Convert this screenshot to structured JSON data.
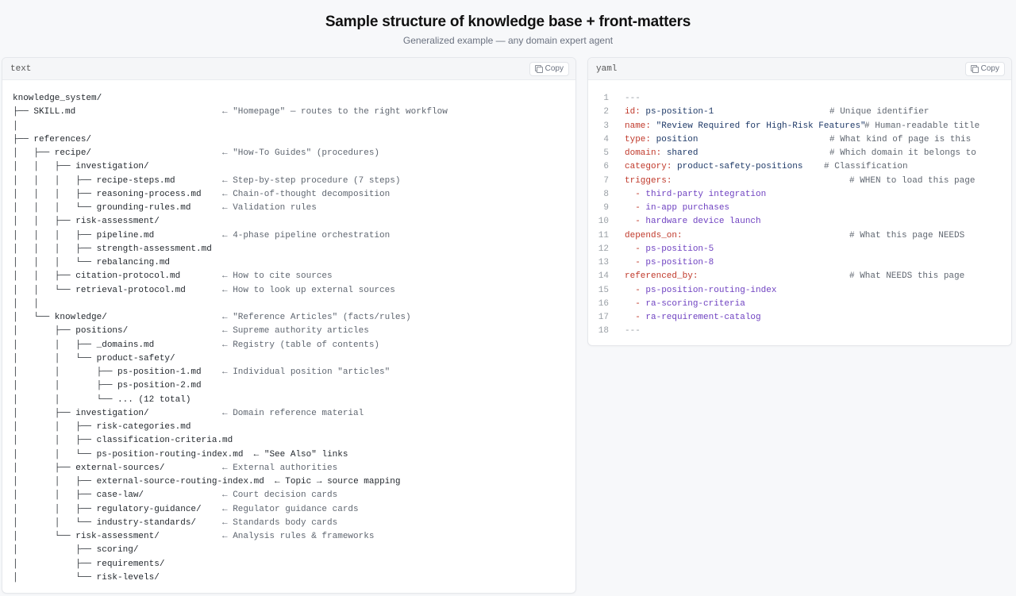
{
  "page": {
    "title": "Sample structure of knowledge base + front-matters",
    "subtitle": "Generalized example — any domain expert agent"
  },
  "text_panel": {
    "language": "text",
    "copy_label": "Copy",
    "lines": [
      {
        "tree": "knowledge_system/",
        "comment": ""
      },
      {
        "tree": "├── SKILL.md",
        "comment": "← \"Homepage\" — routes to the right workflow"
      },
      {
        "tree": "│",
        "comment": ""
      },
      {
        "tree": "├── references/",
        "comment": ""
      },
      {
        "tree": "│   ├── recipe/",
        "comment": "← \"How-To Guides\" (procedures)"
      },
      {
        "tree": "│   │   ├── investigation/",
        "comment": ""
      },
      {
        "tree": "│   │   │   ├── recipe-steps.md",
        "comment": "← Step-by-step procedure (7 steps)"
      },
      {
        "tree": "│   │   │   ├── reasoning-process.md",
        "comment": "← Chain-of-thought decomposition"
      },
      {
        "tree": "│   │   │   └── grounding-rules.md",
        "comment": "← Validation rules"
      },
      {
        "tree": "│   │   ├── risk-assessment/",
        "comment": ""
      },
      {
        "tree": "│   │   │   ├── pipeline.md",
        "comment": "← 4-phase pipeline orchestration"
      },
      {
        "tree": "│   │   │   ├── strength-assessment.md",
        "comment": ""
      },
      {
        "tree": "│   │   │   └── rebalancing.md",
        "comment": ""
      },
      {
        "tree": "│   │   ├── citation-protocol.md",
        "comment": "← How to cite sources"
      },
      {
        "tree": "│   │   └── retrieval-protocol.md",
        "comment": "← How to look up external sources"
      },
      {
        "tree": "│   │",
        "comment": ""
      },
      {
        "tree": "│   └── knowledge/",
        "comment": "← \"Reference Articles\" (facts/rules)"
      },
      {
        "tree": "│       ├── positions/",
        "comment": "← Supreme authority articles"
      },
      {
        "tree": "│       │   ├── _domains.md",
        "comment": "← Registry (table of contents)"
      },
      {
        "tree": "│       │   └── product-safety/",
        "comment": ""
      },
      {
        "tree": "│       │       ├── ps-position-1.md",
        "comment": "← Individual position \"articles\""
      },
      {
        "tree": "│       │       ├── ps-position-2.md",
        "comment": ""
      },
      {
        "tree": "│       │       └── ... (12 total)",
        "comment": ""
      },
      {
        "tree": "│       ├── investigation/",
        "comment": "← Domain reference material"
      },
      {
        "tree": "│       │   ├── risk-categories.md",
        "comment": ""
      },
      {
        "tree": "│       │   ├── classification-criteria.md",
        "comment": ""
      },
      {
        "tree": "│       │   └── ps-position-routing-index.md  ← \"See Also\" links",
        "comment": ""
      },
      {
        "tree": "│       ├── external-sources/",
        "comment": "← External authorities"
      },
      {
        "tree": "│       │   ├── external-source-routing-index.md  ← Topic → source mapping",
        "comment": ""
      },
      {
        "tree": "│       │   ├── case-law/",
        "comment": "← Court decision cards"
      },
      {
        "tree": "│       │   ├── regulatory-guidance/",
        "comment": "← Regulator guidance cards"
      },
      {
        "tree": "│       │   └── industry-standards/",
        "comment": "← Standards body cards"
      },
      {
        "tree": "│       └── risk-assessment/",
        "comment": "← Analysis rules & frameworks"
      },
      {
        "tree": "│           ├── scoring/",
        "comment": ""
      },
      {
        "tree": "│           ├── requirements/",
        "comment": ""
      },
      {
        "tree": "│           └── risk-levels/",
        "comment": ""
      }
    ]
  },
  "yaml_panel": {
    "language": "yaml",
    "copy_label": "Copy",
    "lines": [
      {
        "n": "1",
        "key": "",
        "sep": "",
        "value": "",
        "plain": "---",
        "comment": "",
        "cpos": 0
      },
      {
        "n": "2",
        "key": "id",
        "sep": ":",
        "value": " ps-position-1",
        "plain": "",
        "comment": "# Unique identifier",
        "cpos": 258
      },
      {
        "n": "3",
        "key": "name",
        "sep": ":",
        "value": " \"Review Required for High-Risk Features\"",
        "plain": "",
        "comment": "# Human-readable title",
        "cpos": 302
      },
      {
        "n": "4",
        "key": "type",
        "sep": ":",
        "value": " position",
        "plain": "",
        "comment": "# What kind of page is this",
        "cpos": 258
      },
      {
        "n": "5",
        "key": "domain",
        "sep": ":",
        "value": " shared",
        "plain": "",
        "comment": "# Which domain it belongs to",
        "cpos": 258
      },
      {
        "n": "6",
        "key": "category",
        "sep": ":",
        "value": " product-safety-positions",
        "plain": "",
        "comment": "# Classification",
        "cpos": 251
      },
      {
        "n": "7",
        "key": "triggers",
        "sep": ":",
        "value": "",
        "plain": "",
        "comment": "# WHEN to load this page",
        "cpos": 283
      },
      {
        "n": "8",
        "key": "",
        "sep": "",
        "value": "",
        "item": "third-party integration",
        "comment": "",
        "cpos": 0
      },
      {
        "n": "9",
        "key": "",
        "sep": "",
        "value": "",
        "item": "in-app purchases",
        "comment": "",
        "cpos": 0
      },
      {
        "n": "10",
        "key": "",
        "sep": "",
        "value": "",
        "item": "hardware device launch",
        "comment": "",
        "cpos": 0
      },
      {
        "n": "11",
        "key": "depends_on",
        "sep": ":",
        "value": "",
        "plain": "",
        "comment": "# What this page NEEDS",
        "cpos": 283
      },
      {
        "n": "12",
        "key": "",
        "sep": "",
        "value": "",
        "item": "ps-position-5",
        "comment": "",
        "cpos": 0
      },
      {
        "n": "13",
        "key": "",
        "sep": "",
        "value": "",
        "item": "ps-position-8",
        "comment": "",
        "cpos": 0
      },
      {
        "n": "14",
        "key": "referenced_by",
        "sep": ":",
        "value": "",
        "plain": "",
        "comment": "# What NEEDS this page",
        "cpos": 283
      },
      {
        "n": "15",
        "key": "",
        "sep": "",
        "value": "",
        "item": "ps-position-routing-index",
        "comment": "",
        "cpos": 0
      },
      {
        "n": "16",
        "key": "",
        "sep": "",
        "value": "",
        "item": "ra-scoring-criteria",
        "comment": "",
        "cpos": 0
      },
      {
        "n": "17",
        "key": "",
        "sep": "",
        "value": "",
        "item": "ra-requirement-catalog",
        "comment": "",
        "cpos": 0
      },
      {
        "n": "18",
        "key": "",
        "sep": "",
        "value": "",
        "plain": "---",
        "comment": "",
        "cpos": 0
      }
    ]
  },
  "colors": {
    "yaml_key": "#c0392b",
    "yaml_value": "#1f3a68",
    "yaml_list_item": "#6f42c1",
    "comment": "#5f6670"
  }
}
